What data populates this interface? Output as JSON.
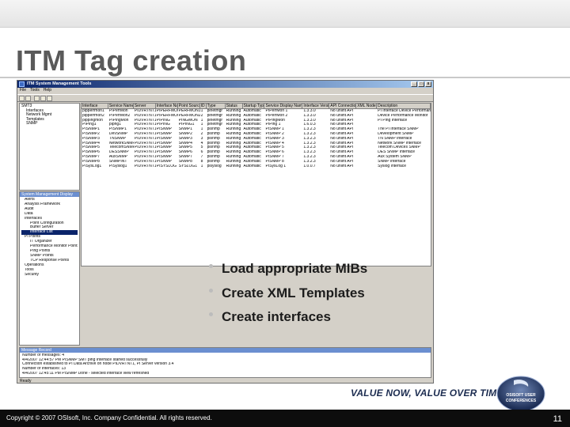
{
  "slide": {
    "title": "ITM Tag creation",
    "bullets": [
      "Load appropriate MIBs",
      "Create XML Templates",
      "Create interfaces"
    ],
    "tagline": "VALUE NOW, VALUE OVER TIME",
    "badge_lines": [
      "OSISOFT USER",
      "CONFERENCES"
    ],
    "copyright": "Copyright © 2007 OSIsoft, Inc. Company Confidential. All rights reserved.",
    "page_number": "11"
  },
  "app": {
    "window_title": "ITM System Management Tools",
    "menu": [
      "File",
      "Tools",
      "Help"
    ],
    "window_buttons": [
      "_",
      "□",
      "x"
    ],
    "tree_items": [
      "SMT3",
      "Interfaces",
      "Network Mgmt",
      "Templates",
      "SNMP"
    ],
    "grid_columns": [
      "Interface",
      "Service Name",
      "Server",
      "Interface Name",
      "Point Source",
      "ID",
      "Type",
      "Status",
      "Startup Type",
      "Service Display Name",
      "Interface Version",
      "API Connection",
      "XML Node",
      "Description"
    ],
    "grid_rows": [
      [
        "pipperfmon1",
        "PIPerfMon",
        "PIDVRTNT1",
        "PIPERFMON",
        "PERFMON1",
        "1",
        "pinetmgr",
        "Running",
        "Automatic",
        "PIPerfMon 1",
        "1.3.3.0",
        "No uniint API",
        "",
        "PI Interface Device Performance Monitor"
      ],
      [
        "pipperfmon2",
        "PIPerfMon2",
        "PIDVRTNT1",
        "PIPERFMON",
        "PERFMON2",
        "2",
        "pinetmgr",
        "Running",
        "Automatic",
        "PIPerfMon 2",
        "1.3.3.0",
        "No uniint API",
        "",
        "Device Performance Monitor"
      ],
      [
        "pippingmon",
        "PIPingMon",
        "PIDVRTNT1",
        "PIPING",
        "PINGMON",
        "1",
        "pinetmgr",
        "Running",
        "Automatic",
        "PIPingMon",
        "1.3.3.0",
        "No uniint API",
        "",
        "PI Ping Interface"
      ],
      [
        "PIPing1",
        "pipng1",
        "PIDVRTNT1",
        "PIPING",
        "PIPING1",
        "1",
        "pinetmgr",
        "Running",
        "Automatic",
        "PIPing 1",
        "1.6.0.3",
        "No uniint API",
        "",
        ""
      ],
      [
        "PISNMP1",
        "PISNMP1",
        "PIDVRTNT1",
        "PISNMP",
        "SNMP1",
        "1",
        "pisnmp",
        "Running",
        "Automatic",
        "PISNMP 1",
        "1.3.2.3",
        "No uniint API",
        "",
        "The PI Interface SNMP"
      ],
      [
        "PISNMP2",
        "DevSNMP",
        "PIDVRTNT1",
        "PISNMP",
        "SNMP2",
        "2",
        "pisnmp",
        "Running",
        "Automatic",
        "PISNMP 2",
        "1.3.2.3",
        "No uniint API",
        "",
        "Development SNMP"
      ],
      [
        "PISNMP3",
        "TNSNMP",
        "PIDVRTNT1",
        "PISNMP",
        "SNMP3",
        "3",
        "pisnmp",
        "Running",
        "Automatic",
        "PISNMP 3",
        "1.3.2.3",
        "No uniint API",
        "",
        "TN SNMP Interface"
      ],
      [
        "PISNMP4",
        "NetworkSNMP",
        "PIDVRTNT1",
        "PISNMP",
        "SNMP4",
        "4",
        "pisnmp",
        "Running",
        "Automatic",
        "PISNMP 4",
        "1.3.2.3",
        "No uniint API",
        "",
        "Network SNMP Interface"
      ],
      [
        "PISNMP5",
        "TelecomSNMP",
        "PIDVRTNT1",
        "PISNMP",
        "SNMP5",
        "5",
        "pisnmp",
        "Running",
        "Automatic",
        "PISNMP 5",
        "1.3.2.3",
        "No uniint API",
        "",
        "Telecom Devices SNMP"
      ],
      [
        "PISNMP6",
        "DESSNMP",
        "PIDVRTNT1",
        "PISNMP",
        "SNMP6",
        "6",
        "pisnmp",
        "Running",
        "Automatic",
        "PISNMP 6",
        "1.3.2.3",
        "No uniint API",
        "",
        "DES SNMP Interface"
      ],
      [
        "PISNMP7",
        "AuxSNMP",
        "PIDVRTNT1",
        "PISNMP",
        "SNMP7",
        "7",
        "pisnmp",
        "Running",
        "Automatic",
        "PISNMP 7",
        "1.3.2.3",
        "No uniint API",
        "",
        "Aux System SNMP"
      ],
      [
        "PISNMP8",
        "SNMPINT",
        "PIDVRTNT1",
        "PISNMP",
        "SNMP8",
        "8",
        "pisnmp",
        "Running",
        "Automatic",
        "PISNMP 8",
        "1.3.2.3",
        "No uniint API",
        "",
        "SNMP Interface"
      ],
      [
        "PISysLog1",
        "PISyslog1",
        "PIDVRTNT1",
        "PISYSLOG",
        "SYSLOG1",
        "1",
        "pisyslog",
        "Running",
        "Automatic",
        "PISysLog 1",
        "1.0.0.7",
        "No uniint API",
        "",
        "Syslog Interface"
      ]
    ],
    "panel2_title": "System Management Display",
    "panel2_items": [
      "Alerts",
      "Analysis Framework",
      "Audit",
      "Data",
      "Interfaces",
      "Point Configuration",
      "Buffer Server",
      "Interface List",
      "PI Points",
      "IT Organizer",
      "Performance Monitor Points",
      "Ping Points",
      "SNMP Points",
      "TCP Response Points",
      "Operations",
      "Tools",
      "Security"
    ],
    "panel2_selected_index": 7,
    "message_title": "Message Record",
    "messages": [
      "Number of messages: 4",
      "4/4/2007 12:44:57 PM PISNMP SMT ping Interface started successfully",
      "Connection established to PI Data Archive on node PIDVRTNT1, PI Server version 3.4",
      "Number of Interfaces: 13",
      "4/4/2007 12:45:11 PM PISNMP Done - selected interface view refreshed"
    ],
    "status_text": "Ready"
  }
}
